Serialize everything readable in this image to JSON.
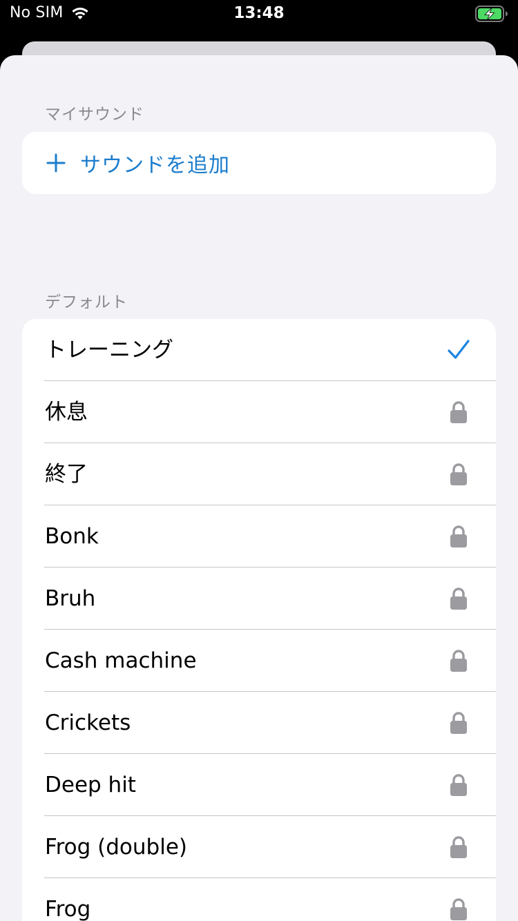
{
  "status_bar": {
    "carrier": "No SIM",
    "time": "13:48",
    "wifi_icon": "wifi-icon",
    "battery_icon": "battery-charging-icon",
    "battery_color": "#4cd964"
  },
  "sections": {
    "my_sounds": {
      "header": "マイサウンド",
      "add_label": "サウンドを追加",
      "add_icon": "plus-icon"
    },
    "defaults": {
      "header": "デフォルト",
      "items": [
        {
          "label": "トレーニング",
          "state": "selected",
          "icon": "checkmark-icon"
        },
        {
          "label": "休息",
          "state": "locked",
          "icon": "lock-icon"
        },
        {
          "label": "終了",
          "state": "locked",
          "icon": "lock-icon"
        },
        {
          "label": "Bonk",
          "state": "locked",
          "icon": "lock-icon"
        },
        {
          "label": "Bruh",
          "state": "locked",
          "icon": "lock-icon"
        },
        {
          "label": "Cash machine",
          "state": "locked",
          "icon": "lock-icon"
        },
        {
          "label": "Crickets",
          "state": "locked",
          "icon": "lock-icon"
        },
        {
          "label": "Deep hit",
          "state": "locked",
          "icon": "lock-icon"
        },
        {
          "label": "Frog (double)",
          "state": "locked",
          "icon": "lock-icon"
        },
        {
          "label": "Frog",
          "state": "locked",
          "icon": "lock-icon"
        }
      ]
    }
  },
  "colors": {
    "accent": "#1a7ccc",
    "checkmark": "#1a84e0",
    "lock": "#9b9ba0",
    "background": "#f2f2f7",
    "section_header": "#8a8a8e"
  }
}
